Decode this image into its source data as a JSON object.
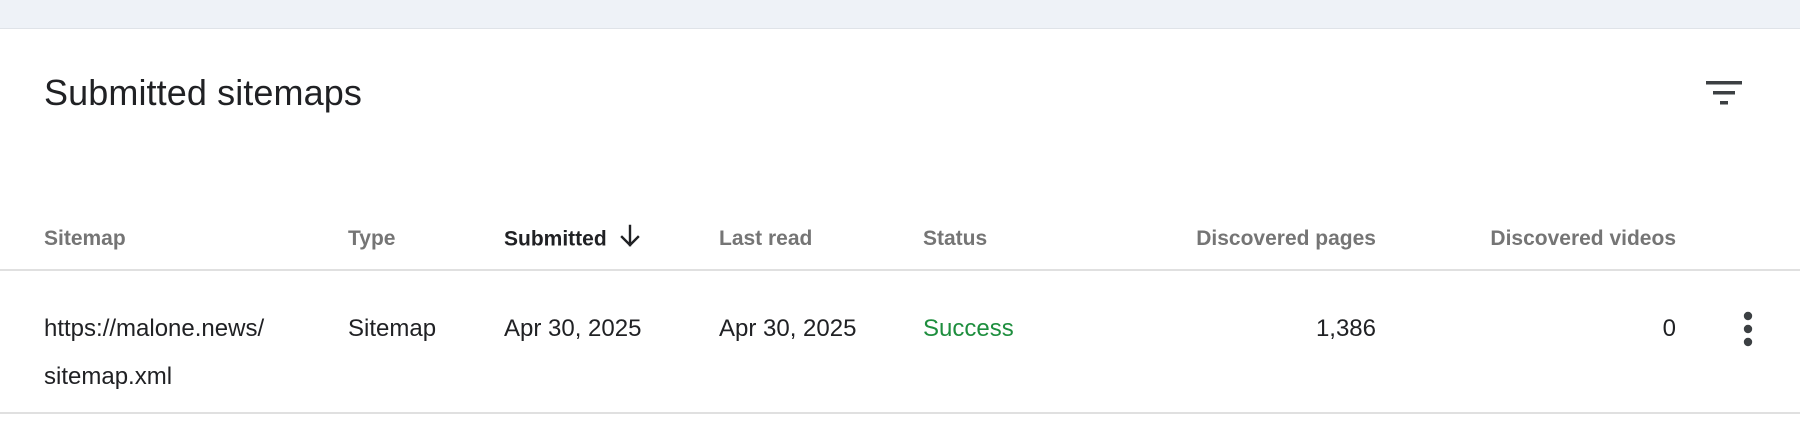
{
  "card": {
    "title": "Submitted sitemaps",
    "filter_icon": "filter-list-icon"
  },
  "table": {
    "columns": [
      {
        "key": "sitemap",
        "label": "Sitemap"
      },
      {
        "key": "type",
        "label": "Type"
      },
      {
        "key": "submitted",
        "label": "Submitted",
        "sorted": "descending"
      },
      {
        "key": "last_read",
        "label": "Last read"
      },
      {
        "key": "status",
        "label": "Status"
      },
      {
        "key": "discovered_pages",
        "label": "Discovered pages"
      },
      {
        "key": "discovered_videos",
        "label": "Discovered videos"
      }
    ],
    "rows": [
      {
        "sitemap_line1": "https://malone.news/",
        "sitemap_line2": "sitemap.xml",
        "type": "Sitemap",
        "submitted": "Apr 30, 2025",
        "last_read": "Apr 30, 2025",
        "status": "Success",
        "discovered_pages": "1,386",
        "discovered_videos": "0"
      }
    ]
  },
  "colors": {
    "status_success": "#1e8e3e",
    "header_text": "#757575",
    "top_band": "#eef2f7"
  }
}
